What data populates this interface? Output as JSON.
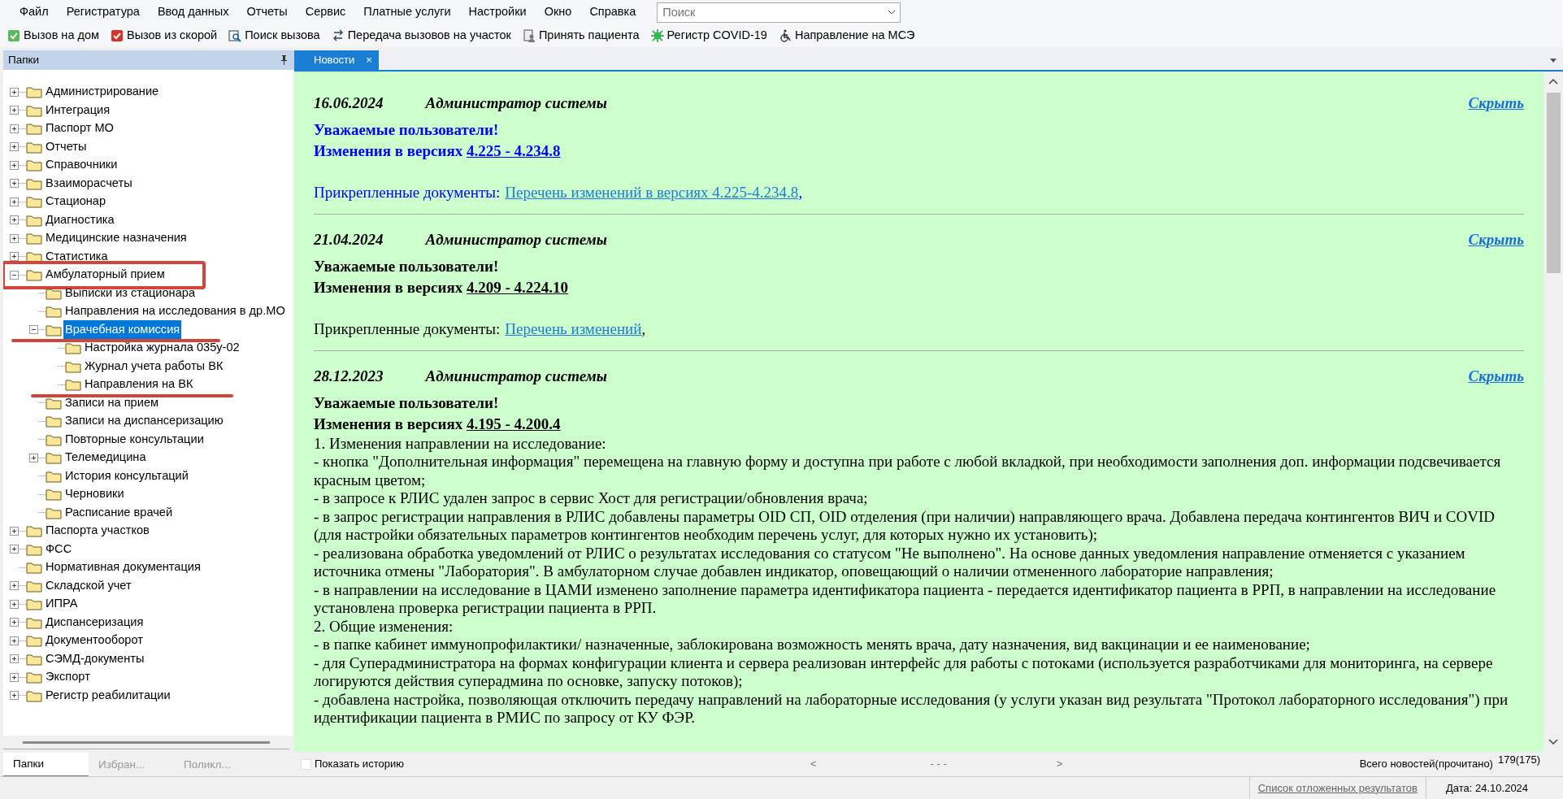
{
  "menu": [
    "Файл",
    "Регистратура",
    "Ввод данных",
    "Отчеты",
    "Сервис",
    "Платные услуги",
    "Настройки",
    "Окно",
    "Справка"
  ],
  "search": {
    "placeholder": "Поиск"
  },
  "toolbar": [
    {
      "label": "Вызов на дом",
      "kind": "home"
    },
    {
      "label": "Вызов из скорой",
      "kind": "ambulance"
    },
    {
      "label": "Поиск вызова",
      "kind": "find"
    },
    {
      "label": "Передача вызовов на участок",
      "kind": "transfer"
    },
    {
      "label": "Принять пациента",
      "kind": "patient"
    },
    {
      "label": "Регистр COVID-19",
      "kind": "covid"
    },
    {
      "label": "Направление на МСЭ",
      "kind": "mse"
    }
  ],
  "folders_panel": {
    "title": "Папки"
  },
  "tree": [
    {
      "label": "Администрирование",
      "kind": "branch",
      "expanded": false,
      "selected": false
    },
    {
      "label": "Интеграция",
      "kind": "branch",
      "expanded": false,
      "selected": false
    },
    {
      "label": "Паспорт МО",
      "kind": "branch",
      "expanded": false,
      "selected": false
    },
    {
      "label": "Отчеты",
      "kind": "branch",
      "expanded": false,
      "selected": false
    },
    {
      "label": "Справочники",
      "kind": "branch",
      "expanded": false,
      "selected": false
    },
    {
      "label": "Взаиморасчеты",
      "kind": "branch",
      "expanded": false,
      "selected": false
    },
    {
      "label": "Стационар",
      "kind": "branch",
      "expanded": false,
      "selected": false
    },
    {
      "label": "Диагностика",
      "kind": "branch",
      "expanded": false,
      "selected": false
    },
    {
      "label": "Медицинские назначения",
      "kind": "branch",
      "expanded": false,
      "selected": false
    },
    {
      "label": "Статистика",
      "kind": "branch",
      "expanded": false,
      "selected": false
    },
    {
      "label": "Амбулаторный прием",
      "kind": "branch",
      "expanded": true,
      "selected": false,
      "boxed": true,
      "children": [
        {
          "label": "Выписки из стационара",
          "kind": "leaf",
          "selected": false
        },
        {
          "label": "Направления на исследования в др.МО",
          "kind": "leaf",
          "selected": false
        },
        {
          "label": "Врачебная комиссия",
          "kind": "branch",
          "expanded": true,
          "selected": true,
          "underlined": true,
          "children": [
            {
              "label": "Настройка журнала 035у-02",
              "kind": "leaf",
              "selected": false
            },
            {
              "label": "Журнал учета работы ВК",
              "kind": "leaf",
              "selected": false
            },
            {
              "label": "Направления на ВК",
              "kind": "leaf",
              "selected": false,
              "underlined": true
            }
          ]
        },
        {
          "label": "Записи на прием",
          "kind": "leaf",
          "selected": false
        },
        {
          "label": "Записи на диспансеризацию",
          "kind": "leaf",
          "selected": false
        },
        {
          "label": "Повторные консультации",
          "kind": "leaf",
          "selected": false
        },
        {
          "label": "Телемедицина",
          "kind": "branch",
          "expanded": false,
          "selected": false
        },
        {
          "label": "История консультаций",
          "kind": "leaf",
          "selected": false
        },
        {
          "label": "Черновики",
          "kind": "leaf",
          "selected": false
        },
        {
          "label": "Расписание врачей",
          "kind": "leaf",
          "selected": false
        }
      ]
    },
    {
      "label": "Паспорта участков",
      "kind": "branch",
      "expanded": false,
      "selected": false
    },
    {
      "label": "ФСС",
      "kind": "branch",
      "expanded": false,
      "selected": false
    },
    {
      "label": "Нормативная документация",
      "kind": "leaf",
      "selected": false
    },
    {
      "label": "Складской учет",
      "kind": "branch",
      "expanded": false,
      "selected": false
    },
    {
      "label": "ИПРА",
      "kind": "branch",
      "expanded": false,
      "selected": false
    },
    {
      "label": "Диспансеризация",
      "kind": "branch",
      "expanded": false,
      "selected": false
    },
    {
      "label": "Документооборот",
      "kind": "branch",
      "expanded": false,
      "selected": false
    },
    {
      "label": "СЭМД-документы",
      "kind": "branch",
      "expanded": false,
      "selected": false
    },
    {
      "label": "Экспорт",
      "kind": "branch",
      "expanded": false,
      "selected": false
    },
    {
      "label": "Регистр реабилитации",
      "kind": "branch",
      "expanded": false,
      "selected": false
    }
  ],
  "bottom_tabs": [
    {
      "label": "Папки",
      "selected": true
    },
    {
      "label": "Избран...",
      "selected": false
    },
    {
      "label": "Поликл...",
      "selected": false
    }
  ],
  "doc_tabs": [
    {
      "label": "Новости",
      "close": "×",
      "selected": true
    }
  ],
  "news": [
    {
      "date": "16.06.2024",
      "author": "Администратор системы",
      "hide": "Скрыть",
      "highlighted": true,
      "greeting": "Уважаемые пользователи!",
      "heading": "Изменения в версиях",
      "version": "4.225 - 4.234.8",
      "attachments_label": "Прикрепленные документы:",
      "attachments": [
        {
          "title": "Перечень изменений в версиях 4.225-4.234.8",
          "separator": ","
        }
      ]
    },
    {
      "date": "21.04.2024",
      "author": "Администратор системы",
      "hide": "Скрыть",
      "highlighted": false,
      "greeting": "Уважаемые пользователи!",
      "heading": "Изменения в версиях",
      "version": "4.209 - 4.224.10",
      "attachments_label": "Прикрепленные документы:",
      "attachments": [
        {
          "title": "Перечень изменений",
          "separator": ","
        }
      ]
    },
    {
      "date": "28.12.2023",
      "author": "Администратор системы",
      "hide": "Скрыть",
      "highlighted": false,
      "greeting": "Уважаемые пользователи!",
      "heading": "Изменения в версиях",
      "version": "4.195 - 4.200.4",
      "body": [
        "1. Изменения направлении на исследование:",
        "- кнопка \"Дополнительная информация\" перемещена на главную форму и доступна при работе с любой вкладкой, при необходимости заполнения доп. информации подсвечивается красным цветом;",
        "- в запросе к РЛИС удален запрос в сервис Хост для регистрации/обновления врача;",
        "- в запрос регистрации направления в РЛИС добавлены параметры OID СП, OID отделения (при наличии) направляющего врача. Добавлена передача контингентов ВИЧ и COVID (для настройки обязательных параметров контингентов необходим перечень услуг, для которых нужно их установить);",
        "- реализована обработка уведомлений от РЛИС о результатах исследования со статусом \"Не выполнено\". На основе данных уведомления направление отменяется с указанием источника отмены \"Лаборатория\". В амбулаторном случае добавлен индикатор, оповещающий о наличии отмененного лабораторие направления;",
        "- в направлении на исследование в ЦАМИ изменено заполнение параметра идентификатора пациента - передается идентификатор пациента в РРП, в направлении на исследование установлена проверка регистрации пациента в РРП.",
        "2. Общие изменения:",
        "- в папке кабинет иммунопрофилактики/ назначенные, заблокирована возможность менять врача, дату назначения, вид вакцинации и ее наименование;",
        "- для Суперадминистратора на формах конфигурации клиента и сервера реализован интерфейс для работы с потоками (используется разработчиками для мониторинга, на сервере логируются действия суперадмина по основке, запуску потоков);",
        "- добавлена настройка, позволяющая отключить передачу направлений на лабораторные исследования (у услуги указан вид результата \"Протокол лабораторного исследования\") при идентификации пациента в РМИС по запросу от КУ ФЭР."
      ]
    }
  ],
  "footer": {
    "show_history": {
      "label": "Показать историю",
      "checked": false
    },
    "prev": "<",
    "page": "- - -",
    "next": ">",
    "total_label": "Всего новостей(прочитано)",
    "total": "179(175)"
  },
  "status_bar": {
    "link": "Список отложенных результатов",
    "date": "Дата: 24.10.2024"
  }
}
